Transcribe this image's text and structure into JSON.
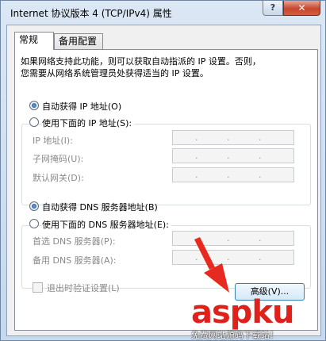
{
  "window": {
    "title": "Internet 协议版本 4 (TCP/IPv4) 属性",
    "help_label": "?",
    "close_label": "✕"
  },
  "tabs": [
    {
      "label": "常规",
      "selected": true
    },
    {
      "label": "备用配置",
      "selected": false
    }
  ],
  "description": {
    "line1": "如果网络支持此功能，则可以获取自动指派的 IP 设置。否则，",
    "line2": "您需要从网络系统管理员处获得适当的 IP 设置。"
  },
  "ip_section": {
    "auto_label": "自动获得 IP 地址(O)",
    "auto_checked": true,
    "manual_label": "使用下面的 IP 地址(S):",
    "manual_checked": false,
    "fields": [
      {
        "label": "IP 地址(I):",
        "value": ". . ."
      },
      {
        "label": "子网掩码(U):",
        "value": ". . ."
      },
      {
        "label": "默认网关(D):",
        "value": ". . ."
      }
    ]
  },
  "dns_section": {
    "auto_label": "自动获得 DNS 服务器地址(B)",
    "auto_checked": true,
    "manual_label": "使用下面的 DNS 服务器地址(E):",
    "manual_checked": false,
    "fields": [
      {
        "label": "首选 DNS 服务器(P):",
        "value": ". . ."
      },
      {
        "label": "备用 DNS 服务器(A):",
        "value": ". . ."
      }
    ]
  },
  "validate_on_exit": {
    "label": "退出时验证设置(L)",
    "checked": false
  },
  "advanced_button": {
    "label": "高级(V)..."
  },
  "watermark": {
    "main": "aspku",
    "sub": "免费网站源码下载站！",
    "color": "#e0201a"
  },
  "colors": {
    "arrow": "#e62a1f",
    "close_button": "#c7462c"
  }
}
